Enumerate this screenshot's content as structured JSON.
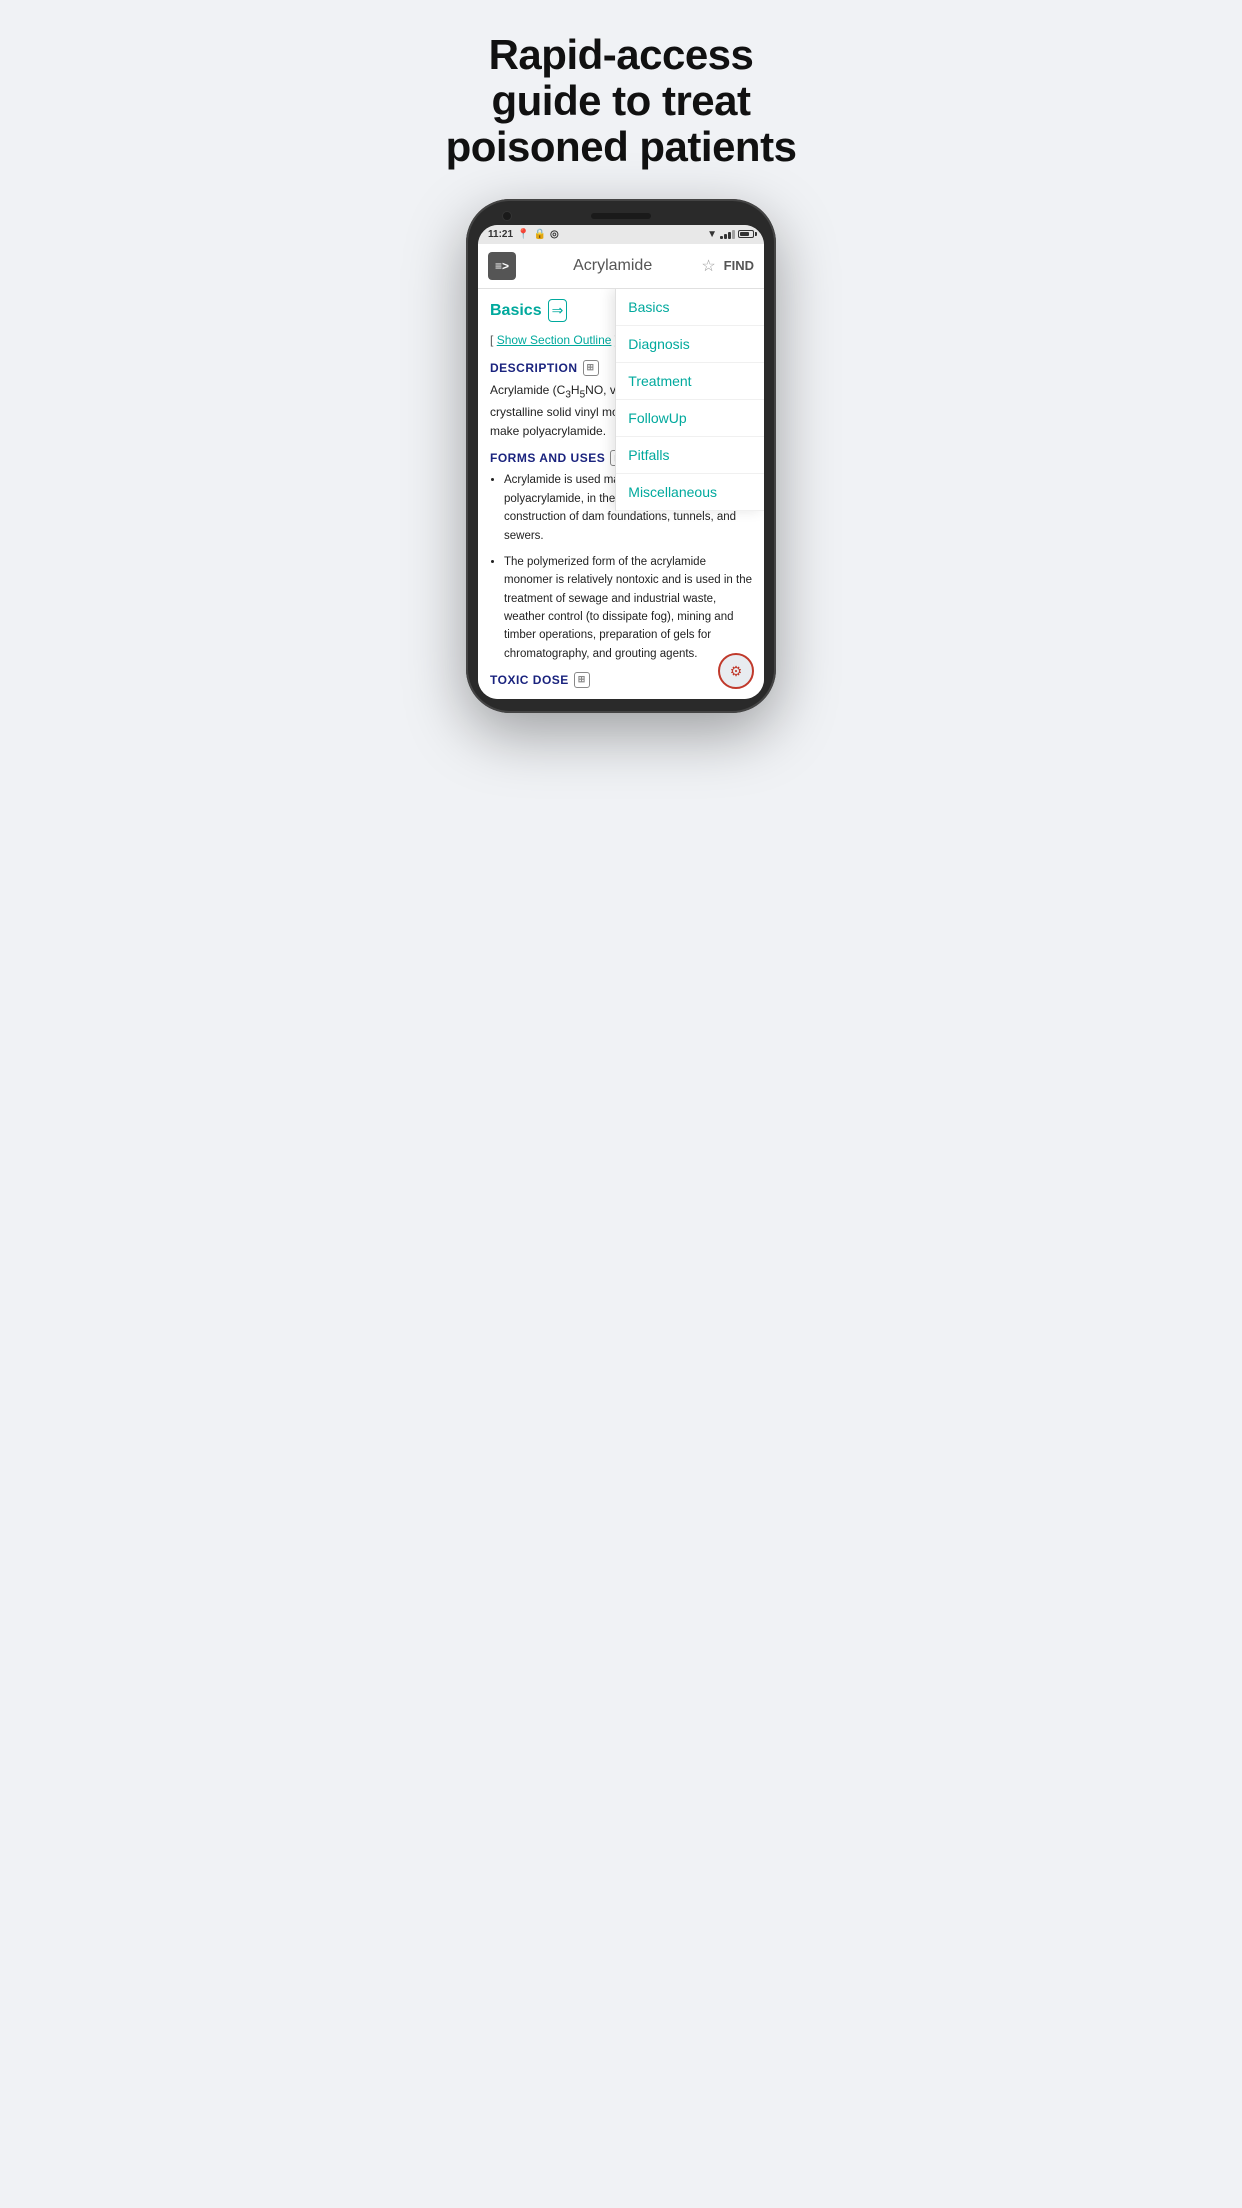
{
  "hero": {
    "title": "Rapid-access guide to treat poisoned patients"
  },
  "statusBar": {
    "time": "11:21",
    "icons": [
      "location",
      "lock",
      "circle"
    ],
    "signal": "wifi",
    "battery": "75"
  },
  "appBar": {
    "logoText": "≡>",
    "title": "Acrylamide",
    "starLabel": "☆",
    "findLabel": "FIND"
  },
  "sectionNav": {
    "items": [
      {
        "label": "Basics",
        "active": false
      },
      {
        "label": "Diagnosis",
        "active": false
      },
      {
        "label": "Treatment",
        "active": false
      },
      {
        "label": "FollowUp",
        "active": false
      },
      {
        "label": "Pitfalls",
        "active": false
      },
      {
        "label": "Miscellaneous",
        "active": false
      }
    ]
  },
  "content": {
    "sectionLabel": "Basics",
    "showOutlinePrefix": "[",
    "showOutlineLink": "Show Section Outline",
    "showOutlineSuffix": "]",
    "descriptionHeader": "DESCRIPTION",
    "descriptionText": "Acrylamide (C₃H₅NO, vinyl amide) is a white crystalline solid vinyl monomer that is used to make polyacrylamide.",
    "formsHeader": "FORMS AND USES",
    "bulletItems": [
      "Acrylamide is used mainly in the production of polyacrylamide, in the synthesis of dyes, and in construction of dam foundations, tunnels, and sewers.",
      "The polymerized form of the acrylamide monomer is relatively nontoxic and is used in the treatment of sewage and industrial waste, weather control (to dissipate fog), mining and timber operations, preparation of gels for chromatography, and grouting agents."
    ],
    "toxicDoseHeader": "TOXIC DOSE"
  },
  "colors": {
    "teal": "#00a99d",
    "darkBlue": "#1a237e",
    "red": "#c0392b",
    "textDark": "#222222",
    "bgLight": "#f0f2f5"
  }
}
